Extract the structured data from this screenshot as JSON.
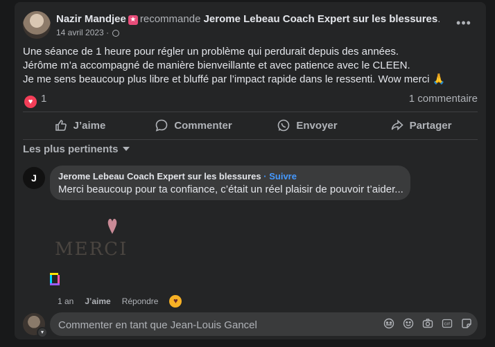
{
  "post": {
    "author": "Nazir Mandjee",
    "recommends": "recommande",
    "page": "Jerome Lebeau Coach Expert sur les blessures",
    "period": ".",
    "date": "14 avril 2023",
    "dot": "·",
    "more": "•••",
    "body_lines": [
      "Une séance de 1 heure pour régler un problème qui perdurait depuis des années.",
      "Jérôme m’a accompagné de manière bienveillante et avec patience avec le CLEEN.",
      "Je me sens beaucoup plus libre et bluffé par l’impact rapide dans le ressenti. Wow merci 🙏"
    ],
    "reaction_count": "1",
    "comment_count": "1 commentaire"
  },
  "actions": {
    "like": "J’aime",
    "comment": "Commenter",
    "send": "Envoyer",
    "share": "Partager"
  },
  "comments": {
    "sort_label": "Les plus pertinents",
    "items": [
      {
        "author": "Jerome Lebeau Coach Expert sur les blessures",
        "follow": "Suivre",
        "text": "Merci beaucoup pour ta confiance, c’était un réel plaisir de pouvoir t’aider...",
        "sticker_text": "MERCI",
        "time": "1 an",
        "like": "J’aime",
        "reply": "Répondre"
      }
    ]
  },
  "composer": {
    "placeholder": "Commenter en tant que Jean-Louis Gancel"
  },
  "icons": {
    "badge": "recommend-star-icon",
    "heart": "heart-reaction-icon",
    "accent": "#4599ff",
    "heart_color": "#f33e58"
  }
}
